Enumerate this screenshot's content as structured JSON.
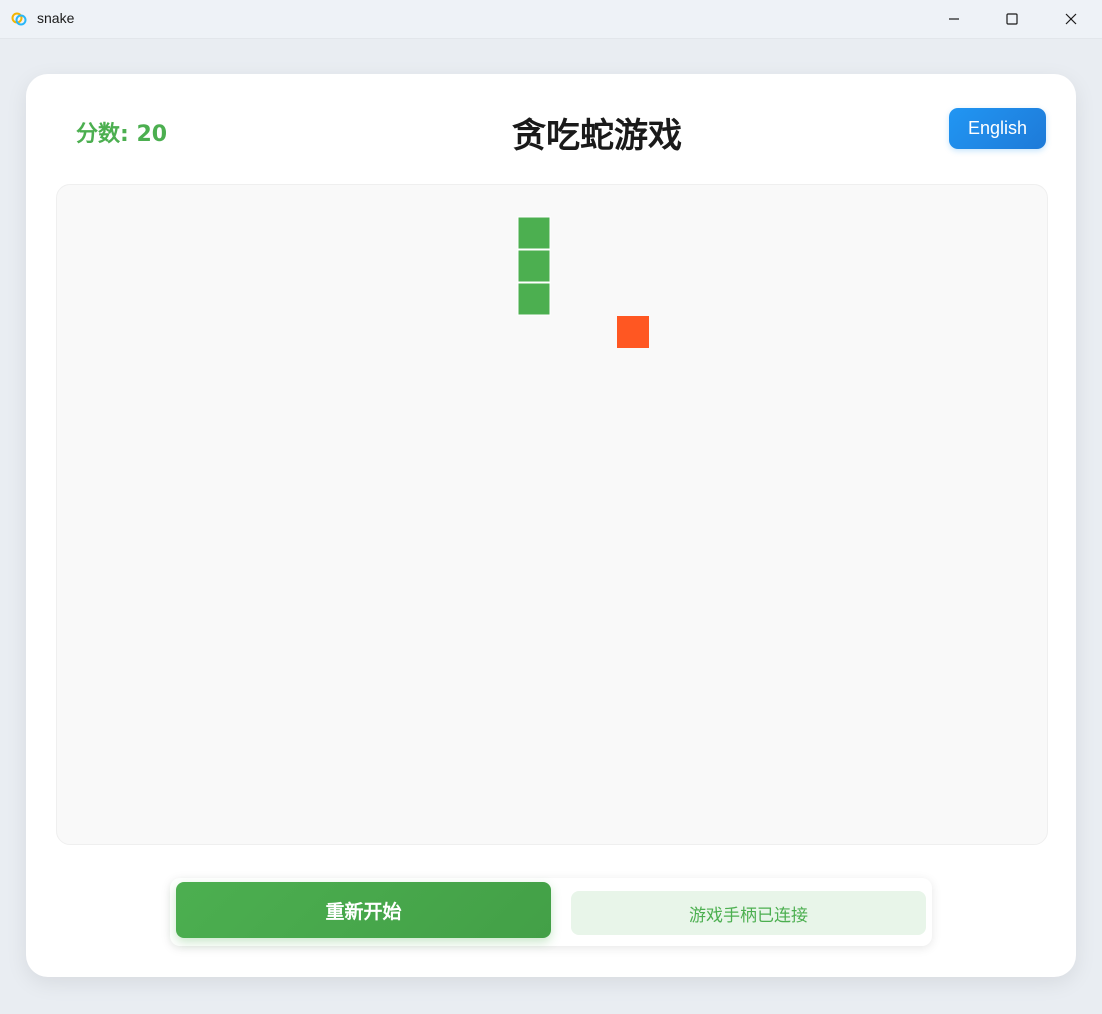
{
  "window": {
    "title": "snake",
    "icon": "app-logo-icon",
    "controls": [
      "minimize-icon",
      "maximize-icon",
      "close-icon"
    ]
  },
  "header": {
    "score_text": "分数: 20",
    "title": "贪吃蛇游戏",
    "language_button": "English"
  },
  "board": {
    "snake_segments": 3,
    "snake_color": "#4caf50",
    "food_color": "#ff5722",
    "background": "#f9f9f9"
  },
  "controls": {
    "restart_label": "重新开始",
    "gamepad_status": "游戏手柄已连接"
  },
  "colors": {
    "accent": "#4caf50",
    "button_blue": "#2196f3"
  }
}
